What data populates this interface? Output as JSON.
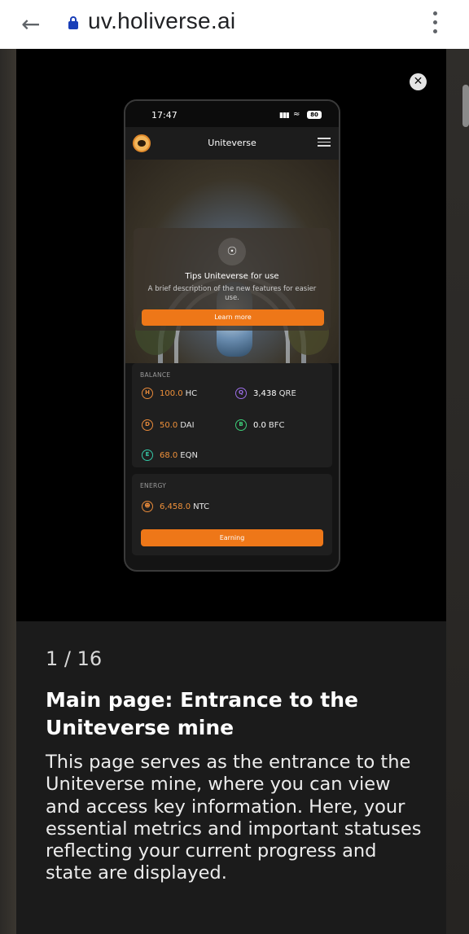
{
  "browser": {
    "url": "uv.holiverse.ai",
    "icons": {
      "back": "back-arrow-icon",
      "lock": "lock-icon",
      "menu": "kebab-menu-icon"
    }
  },
  "modal": {
    "close_icon": "close-icon",
    "phone": {
      "time": "17:47",
      "battery": "80",
      "app_title": "Uniteverse",
      "tip": {
        "title": "Tips Uniteverse for use",
        "description": "A brief description of the new features for easier use.",
        "button": "Learn more"
      },
      "balance": {
        "label": "BALANCE",
        "items": [
          {
            "value": "100.0",
            "unit": "HC",
            "icon": "H",
            "color": "#e98a3a",
            "value_color": "#f0913a"
          },
          {
            "value": "3,438",
            "unit": "QRE",
            "icon": "Q",
            "color": "#9c6ee8",
            "value_color": "#ffffff"
          },
          {
            "value": "50.0",
            "unit": "DAI",
            "icon": "D",
            "color": "#e98a3a",
            "value_color": "#f0913a"
          },
          {
            "value": "0.0",
            "unit": "BFC",
            "icon": "B",
            "color": "#3ed07a",
            "value_color": "#ffffff"
          },
          {
            "value": "68.0",
            "unit": "EQN",
            "icon": "E",
            "color": "#35c8a8",
            "value_color": "#f0913a"
          }
        ]
      },
      "energy": {
        "label": "ENERGY",
        "value": "6,458.0",
        "unit": "NTC",
        "button": "Earning"
      }
    }
  },
  "slide": {
    "counter": "1 / 16",
    "title": "Main page: Entrance to the Uniteverse mine",
    "body": "This page serves as the entrance to the Uniteverse mine, where you can view and access key information. Here, your essential metrics and important statuses reflecting your current progress and state are displayed."
  },
  "colors": {
    "accent": "#ee7718",
    "modal_bg": "#000000",
    "slide_bg": "#1b1b1b"
  }
}
